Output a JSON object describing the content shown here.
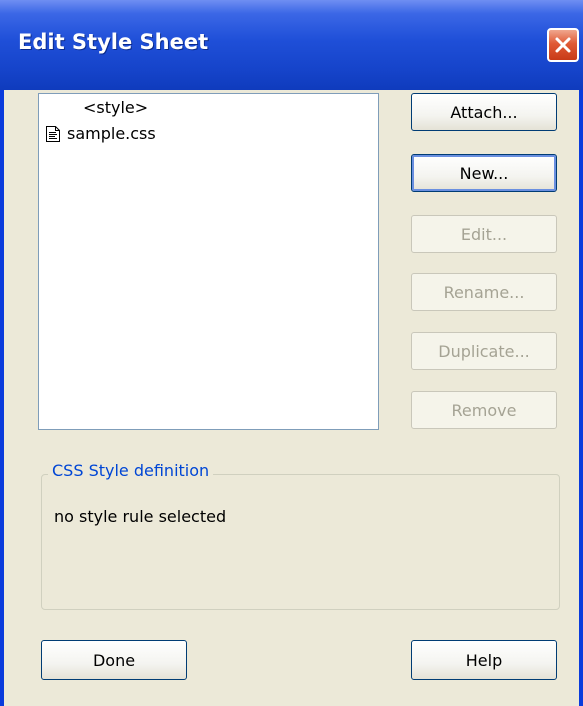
{
  "window": {
    "title": "Edit Style Sheet",
    "close_icon": "close-icon",
    "accent_color": "#1f4fd8"
  },
  "stylesheets": {
    "items": [
      {
        "label": "<style>",
        "icon": "none"
      },
      {
        "label": "sample.css",
        "icon": "css-file-icon"
      }
    ]
  },
  "buttons": {
    "attach": {
      "label": "Attach...",
      "enabled": true
    },
    "new": {
      "label": "New...",
      "enabled": true
    },
    "edit": {
      "label": "Edit...",
      "enabled": false
    },
    "rename": {
      "label": "Rename...",
      "enabled": false
    },
    "duplicate": {
      "label": "Duplicate...",
      "enabled": false
    },
    "remove": {
      "label": "Remove",
      "enabled": false
    },
    "done": {
      "label": "Done",
      "enabled": true
    },
    "help": {
      "label": "Help",
      "enabled": true
    }
  },
  "definition": {
    "legend": "CSS Style definition",
    "text": "no style rule selected"
  }
}
